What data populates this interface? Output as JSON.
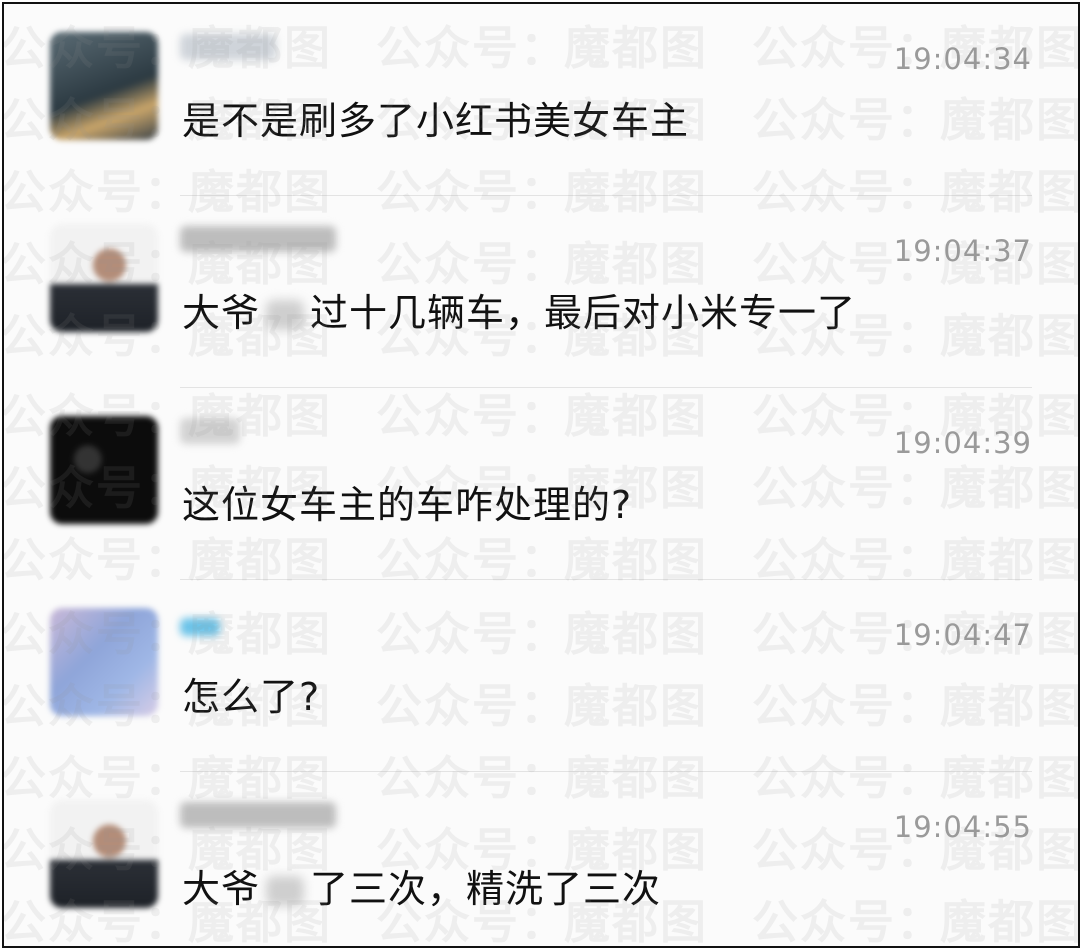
{
  "messages": [
    {
      "time": "19:04:34",
      "text": "是不是刷多了小红书美女车主"
    },
    {
      "time": "19:04:37",
      "text_before": "大爷",
      "text_after": "过十几辆车，最后对小米专一了"
    },
    {
      "time": "19:04:39",
      "text": "这位女车主的车咋处理的?"
    },
    {
      "time": "19:04:47",
      "text": "怎么了?"
    },
    {
      "time": "19:04:55",
      "text_before": "大爷",
      "text_after": "了三次，精洗了三次"
    }
  ],
  "watermark": {
    "a": "公众号：",
    "b": "魔都图"
  }
}
